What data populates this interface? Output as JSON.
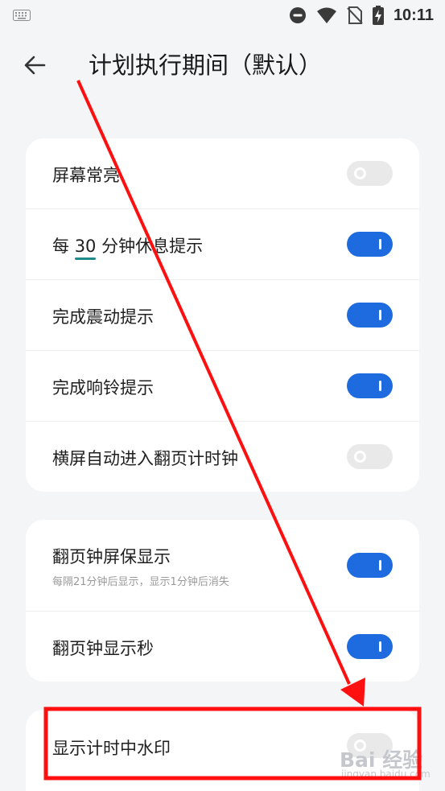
{
  "status_bar": {
    "time": "10:11"
  },
  "header": {
    "title": "计划执行期间（默认）"
  },
  "card1": {
    "rows": [
      {
        "label": "屏幕常亮",
        "on": false
      },
      {
        "label_pre": "每 ",
        "label_num": "30",
        "label_post": " 分钟休息提示",
        "on": true
      },
      {
        "label": "完成震动提示",
        "on": true
      },
      {
        "label": "完成响铃提示",
        "on": true
      },
      {
        "label": "横屏自动进入翻页计时钟",
        "on": false
      }
    ]
  },
  "card2": {
    "rows": [
      {
        "label": "翻页钟屏保显示",
        "sublabel": "每隔21分钟后显示，显示1分钟后消失",
        "on": true
      },
      {
        "label": "翻页钟显示秒",
        "on": true
      }
    ]
  },
  "card3": {
    "rows": [
      {
        "label": "显示计时中水印",
        "on": false
      }
    ]
  },
  "watermark": {
    "logo": "Bai 经验",
    "url": "jingyan.baidu.com"
  },
  "colors": {
    "accent": "#1e6bdf",
    "annotation": "#ff1010",
    "background": "#f4f5f7"
  }
}
